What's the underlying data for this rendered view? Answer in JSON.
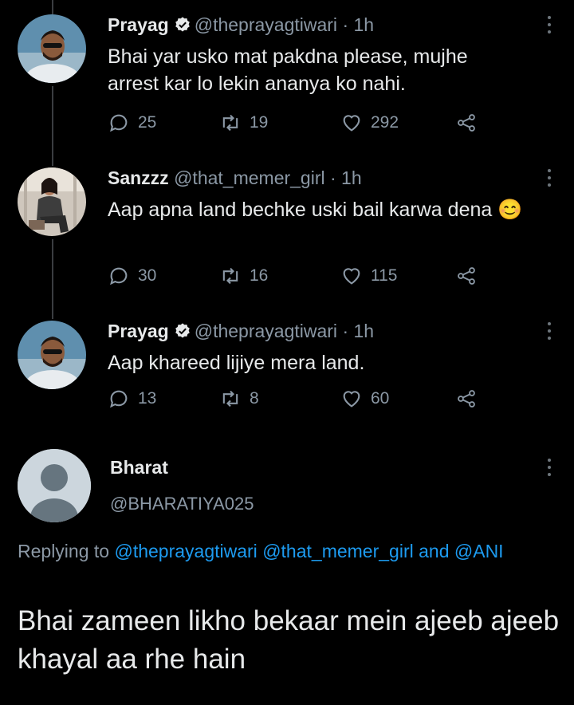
{
  "tweets": [
    {
      "name": "Prayag",
      "handle": "@theprayagtiwari",
      "time": "· 1h",
      "text": "Bhai yar usko mat pakdna please, mujhe arrest kar lo lekin ananya ko nahi.",
      "replies": "25",
      "retweets": "19",
      "likes": "292",
      "verified": true
    },
    {
      "name": "Sanzzz",
      "handle": "@that_memer_girl",
      "time": "· 1h",
      "text": "Aap apna land bechke uski bail karwa dena 😊",
      "replies": "30",
      "retweets": "16",
      "likes": "115",
      "verified": false
    },
    {
      "name": "Prayag",
      "handle": "@theprayagtiwari",
      "time": "· 1h",
      "text": "Aap khareed lijiye mera land.",
      "replies": "13",
      "retweets": "8",
      "likes": "60",
      "verified": true
    }
  ],
  "main": {
    "name": "Bharat",
    "handle": "@BHARATIYA025",
    "replying_prefix": "Replying to",
    "replying_user1": "@theprayagtiwari",
    "replying_user2": "@that_memer_girl",
    "replying_and": "and",
    "replying_user3": "@ANI",
    "text": "Bhai zameen likho bekaar mein ajeeb ajeeb khayal aa rhe hain"
  },
  "colors": {
    "background": "#000000",
    "text": "#e7e9ea",
    "muted": "#8b98a5",
    "link": "#1d9bf0",
    "verified": "#e7e9ea"
  },
  "icons": [
    "reply-icon",
    "retweet-icon",
    "like-icon",
    "share-icon",
    "verified-icon",
    "more-icon"
  ]
}
